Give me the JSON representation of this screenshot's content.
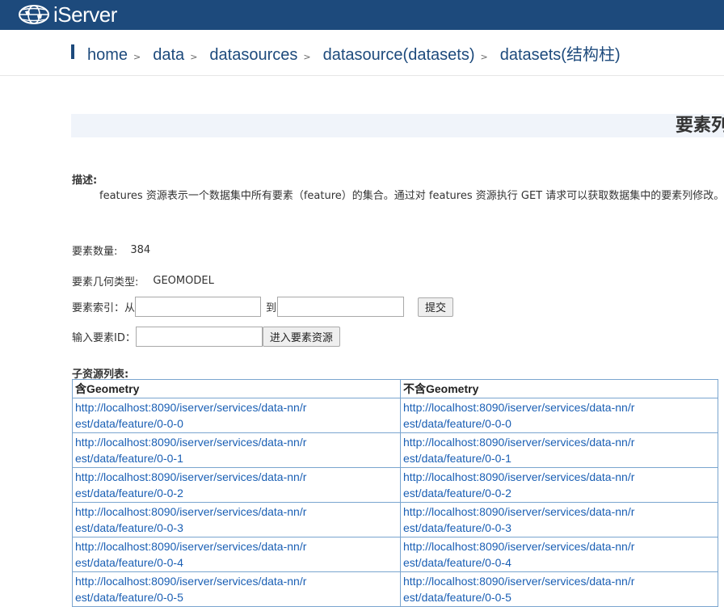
{
  "brand": {
    "logo_text": "iServer"
  },
  "breadcrumb": [
    {
      "label": "home"
    },
    {
      "label": "data"
    },
    {
      "label": "datasources"
    },
    {
      "label": "datasource(datasets)"
    },
    {
      "label": "datasets(结构柱)"
    }
  ],
  "crumb_separator": ">",
  "page": {
    "title": "要素列"
  },
  "description": {
    "label": "描述:",
    "text": "features 资源表示一个数据集中所有要素（feature）的集合。通过对 features 资源执行 GET 请求可以获取数据集中的要素列修改。"
  },
  "feature_count": {
    "label": "要素数量:",
    "value": "384"
  },
  "geometry_type": {
    "label": "要素几何类型:",
    "value": "GEOMODEL"
  },
  "index_form": {
    "label": "要素索引：从",
    "to_label": "到",
    "from_value": "",
    "to_value": "",
    "submit_label": "提交"
  },
  "id_form": {
    "label": "输入要素ID：",
    "value": "",
    "enter_label": "进入要素资源"
  },
  "child_resources": {
    "label": "子资源列表:",
    "headers": [
      "含Geometry",
      "不含Geometry"
    ],
    "rows": [
      [
        "http://localhost:8090/iserver/services/data-nn/rest/data/feature/0-0-0",
        "http://localhost:8090/iserver/services/data-nn/rest/data/feature/0-0-0"
      ],
      [
        "http://localhost:8090/iserver/services/data-nn/rest/data/feature/0-0-1",
        "http://localhost:8090/iserver/services/data-nn/rest/data/feature/0-0-1"
      ],
      [
        "http://localhost:8090/iserver/services/data-nn/rest/data/feature/0-0-2",
        "http://localhost:8090/iserver/services/data-nn/rest/data/feature/0-0-2"
      ],
      [
        "http://localhost:8090/iserver/services/data-nn/rest/data/feature/0-0-3",
        "http://localhost:8090/iserver/services/data-nn/rest/data/feature/0-0-3"
      ],
      [
        "http://localhost:8090/iserver/services/data-nn/rest/data/feature/0-0-4",
        "http://localhost:8090/iserver/services/data-nn/rest/data/feature/0-0-4"
      ],
      [
        "http://localhost:8090/iserver/services/data-nn/rest/data/feature/0-0-5",
        "http://localhost:8090/iserver/services/data-nn/rest/data/feature/0-0-5"
      ]
    ]
  },
  "colors": {
    "brand": "#1d4a7c",
    "link": "#1a5fb4",
    "table_border": "#7aa5cf",
    "title_band": "#f0f4fa"
  }
}
